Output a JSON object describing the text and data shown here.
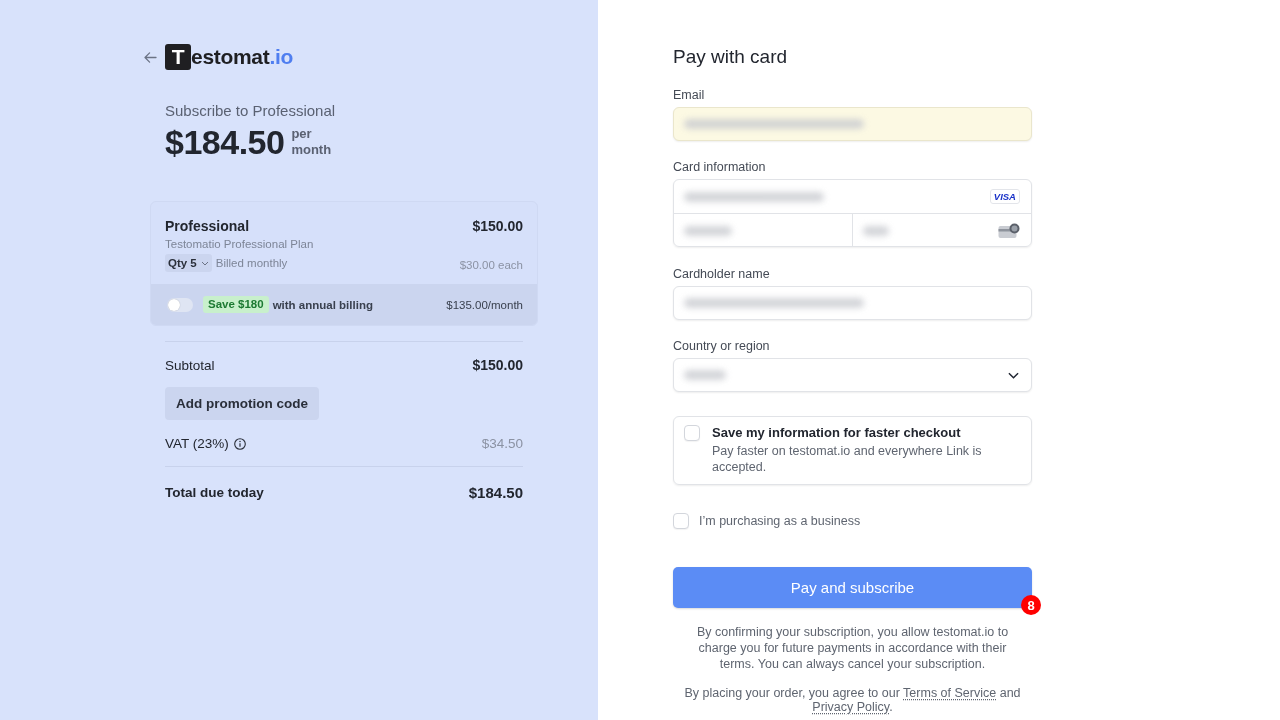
{
  "brand": {
    "mark": "T",
    "name": "estomat",
    "suffix": ".io"
  },
  "summary": {
    "title": "Subscribe to Professional",
    "price": "$184.50",
    "period": "per month"
  },
  "line_item": {
    "name": "Professional",
    "price": "$150.00",
    "description": "Testomatio Professional Plan",
    "quantity": "Qty 5",
    "billing": "Billed monthly",
    "unit_price": "$30.00 each"
  },
  "annual_billing": {
    "on": false,
    "badge": "Save $180",
    "label": "with annual billing",
    "price": "$135.00/month"
  },
  "subtotal": {
    "label": "Subtotal",
    "value": "$150.00"
  },
  "promotion_button": "Add promotion code",
  "vat": {
    "label": "VAT (23%)",
    "value": "$34.50"
  },
  "total": {
    "label": "Total due today",
    "value": "$184.50"
  },
  "payment": {
    "title": "Pay with card",
    "fields": [
      {
        "kind": "text",
        "label": "Email",
        "autofilled": true,
        "value_hidden": true
      },
      {
        "kind": "card",
        "label": "Card information",
        "parts": [
          {
            "kind": "number",
            "value_hidden": true,
            "brand": "VISA"
          },
          {
            "kind": "expiry",
            "value_hidden": true
          },
          {
            "kind": "cvc",
            "value_hidden": true
          }
        ]
      },
      {
        "kind": "text",
        "label": "Cardholder name",
        "autofilled": false,
        "value_hidden": true
      },
      {
        "kind": "select",
        "label": "Country or region",
        "autofilled": false,
        "value_hidden": true
      }
    ],
    "save_info": {
      "checked": false,
      "title": "Save my information for faster checkout",
      "description": "Pay faster on testomat.io and everywhere Link is accepted."
    },
    "business": {
      "checked": false,
      "label": "I’m purchasing as a business"
    },
    "submit_button": "Pay and subscribe",
    "step_marker": "8",
    "consent_text": "By confirming your subscription, you allow testomat.io to charge you for future payments in accordance with their terms. You can always cancel your subscription.",
    "legal_text": [
      {
        "kind": "text",
        "text": "By placing your order, you agree to our "
      },
      {
        "kind": "link",
        "text": "Terms of Service"
      },
      {
        "kind": "text",
        "text": " and "
      },
      {
        "kind": "link",
        "text": "Privacy Policy"
      },
      {
        "kind": "text",
        "text": "."
      }
    ]
  }
}
